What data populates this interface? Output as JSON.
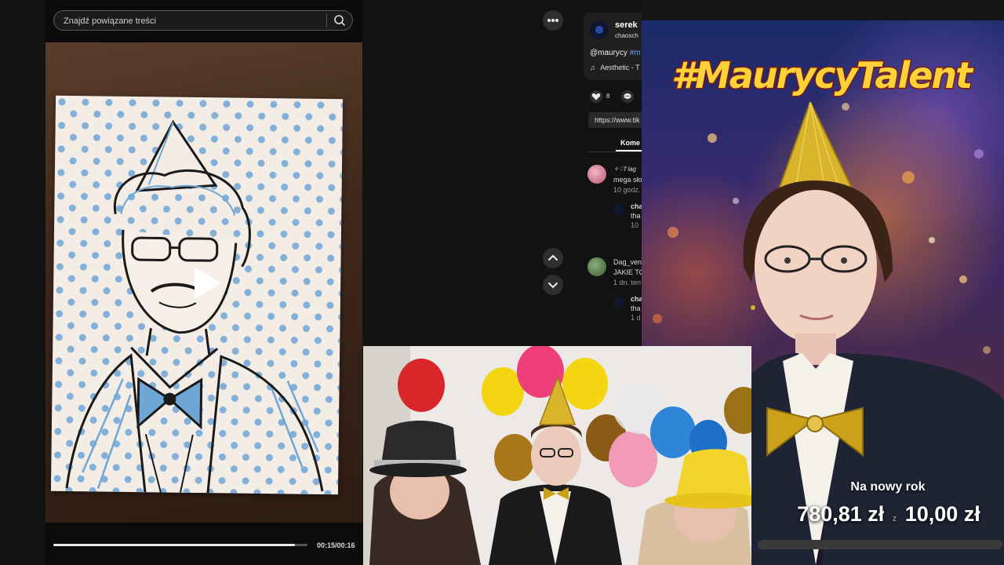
{
  "player": {
    "search_placeholder": "Znajdź powiązane treści",
    "time": "00:15/00:16",
    "progress": 0.95
  },
  "post": {
    "author_name": "serek",
    "author_handle": "chaosch",
    "caption_mention": "@maurycy",
    "caption_hashtag": "#m",
    "music": "Aesthetic - T",
    "likes": "8",
    "link": "https://www.tik",
    "tab_comments": "Kome"
  },
  "comments": [
    {
      "user": "✧♡f lag",
      "text": "mega sło",
      "time": "10 godz.",
      "reply": {
        "user": "cha",
        "text": "tha",
        "time": "10"
      }
    },
    {
      "user": "Dag_ven",
      "text": "JAKIE TO",
      "time": "1 dn. ten",
      "reply": {
        "user": "cha",
        "text": "tha",
        "time": "1 d"
      }
    }
  ],
  "stream": {
    "hashtag": "#MaurycyTalent",
    "goal_label": "Na nowy rok",
    "goal_current": "780,81 zł",
    "goal_target": "10,00 zł",
    "goal_separator": "z"
  },
  "colors": {
    "hashtag_fill": "#ffd23a",
    "hashtag_accent": "#ffffff",
    "sketch_ink": "#1a1a1a",
    "sketch_blue": "#6ea6d6",
    "party_hat": "#d9b42a"
  }
}
